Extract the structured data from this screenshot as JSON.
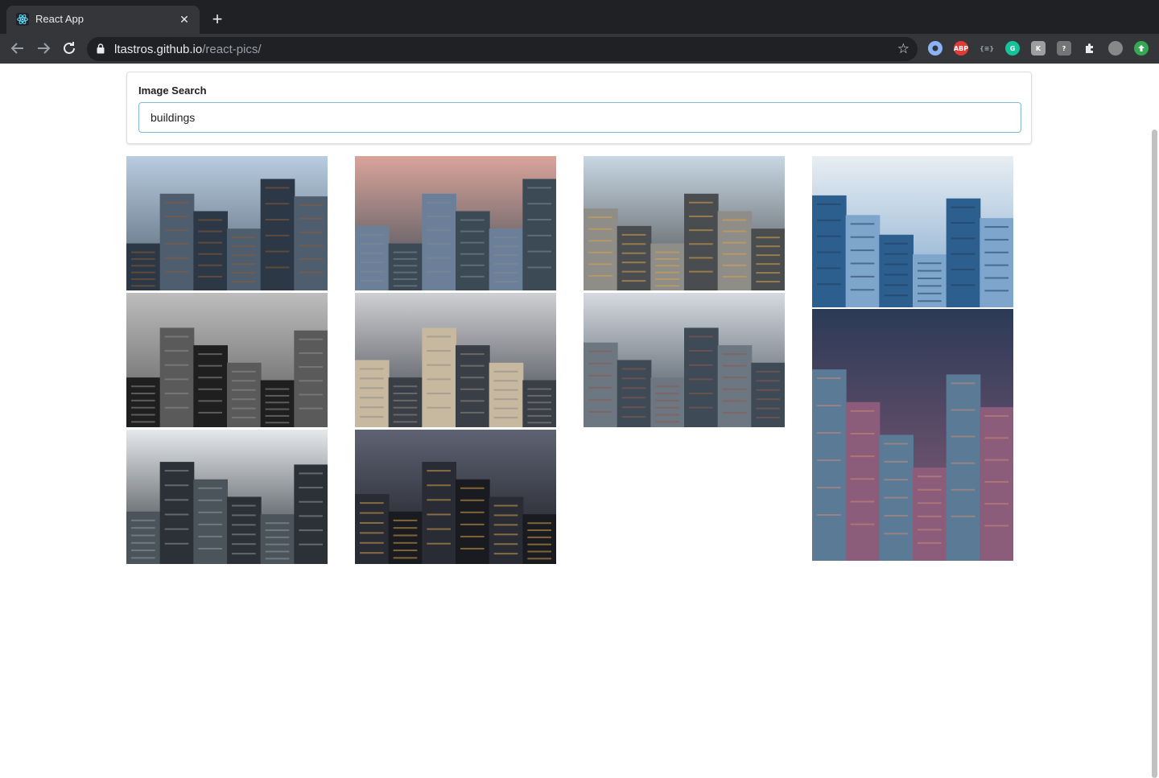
{
  "browser": {
    "tab_title": "React App",
    "url_host": "ltastros.github.io",
    "url_path": "/react-pics/",
    "extensions": [
      {
        "name": "shield-ext-icon",
        "label": "",
        "color": "#8ab4f8"
      },
      {
        "name": "adblock-plus-icon",
        "label": "ABP",
        "color": "#e53935"
      },
      {
        "name": "json-viewer-icon",
        "label": "{≡}",
        "color": "#35363a"
      },
      {
        "name": "grammarly-icon",
        "label": "G",
        "color": "#15c39a"
      },
      {
        "name": "k-extension-icon",
        "label": "K",
        "color": "#9e9e9e"
      },
      {
        "name": "help-extension-icon",
        "label": "?",
        "color": "#757575"
      },
      {
        "name": "puzzle-extensions-icon",
        "label": "",
        "color": "#35363a"
      },
      {
        "name": "profile-avatar-icon",
        "label": "",
        "color": "#888888"
      },
      {
        "name": "update-icon",
        "label": "",
        "color": "#34a853"
      }
    ]
  },
  "search": {
    "label": "Image Search",
    "value": "buildings"
  },
  "images": [
    {
      "name": "skyscrapers-looking-up-image",
      "palette": [
        "#b9cde0",
        "#2c3846",
        "#4f5e6f",
        "#8a5a34"
      ]
    },
    {
      "name": "nyc-skyline-sunset-image",
      "palette": [
        "#d9a49a",
        "#6b8098",
        "#3b4a55",
        "#7c8a93"
      ]
    },
    {
      "name": "city-street-golden-light-image",
      "palette": [
        "#c8d7e3",
        "#8e8d88",
        "#4a4d50",
        "#d8a24a"
      ]
    },
    {
      "name": "glass-tower-blue-image",
      "palette": [
        "#e8eef3",
        "#2d5f8e",
        "#7ea6cc",
        "#1f3d5c"
      ]
    },
    {
      "name": "bw-skyscrapers-clouds-image",
      "palette": [
        "#bdbdbd",
        "#1f1f1f",
        "#5a5a5a",
        "#8e8e8e"
      ]
    },
    {
      "name": "modern-building-corner-image",
      "palette": [
        "#cfd0d3",
        "#c7b8a0",
        "#3a3e46",
        "#8e8a84"
      ]
    },
    {
      "name": "boston-skyline-image",
      "palette": [
        "#d6dae0",
        "#6c7781",
        "#3e4a55",
        "#8c5a4e"
      ]
    },
    {
      "name": "city-street-dusk-image",
      "palette": [
        "#2b3a56",
        "#5b7a96",
        "#8b5d7a",
        "#c88a78"
      ]
    },
    {
      "name": "foggy-skyscrapers-image",
      "palette": [
        "#e6e9ec",
        "#4c545b",
        "#2b3136",
        "#8e979e"
      ]
    },
    {
      "name": "toronto-night-skyline-image",
      "palette": [
        "#5e6373",
        "#2a2c35",
        "#1a1b21",
        "#d2a24c"
      ]
    }
  ]
}
